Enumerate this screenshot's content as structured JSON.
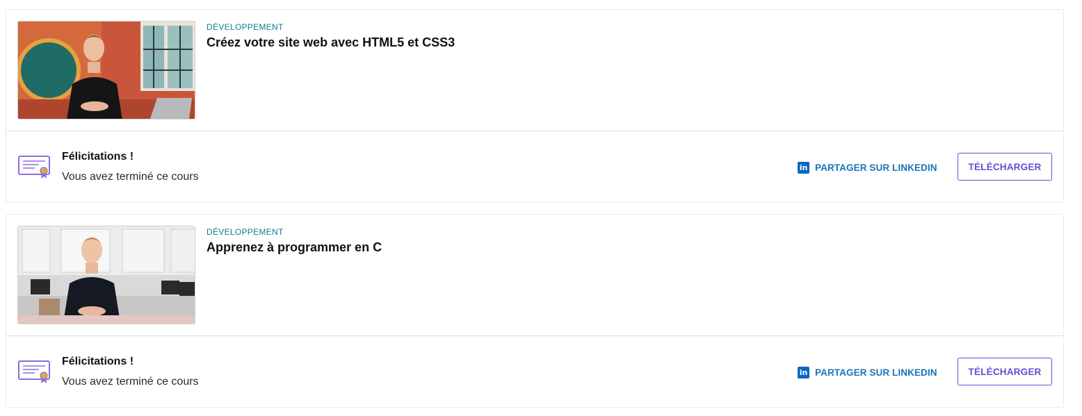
{
  "courses": [
    {
      "category": "DÉVELOPPEMENT",
      "title": "Créez votre site web avec HTML5 et CSS3",
      "thumbnail_alt": "Instructor in black t-shirt seated at desk with laptop",
      "congrats": "Félicitations !",
      "completed": "Vous avez terminé ce cours",
      "linkedin_label": "PARTAGER SUR LINKEDIN",
      "download_label": "TÉLÉCHARGER"
    },
    {
      "category": "DÉVELOPPEMENT",
      "title": "Apprenez à programmer en C",
      "thumbnail_alt": "Instructor in black sweater seated at desk in office",
      "congrats": "Félicitations !",
      "completed": "Vous avez terminé ce cours",
      "linkedin_label": "PARTAGER SUR LINKEDIN",
      "download_label": "TÉLÉCHARGER"
    }
  ],
  "colors": {
    "category": "#0f7c8f",
    "accent": "#6a4bd6",
    "linkedin": "#0a66c2",
    "linkedin_text": "#1a73b8"
  },
  "icons": {
    "certificate": "certificate-icon",
    "linkedin": "linkedin-icon"
  }
}
